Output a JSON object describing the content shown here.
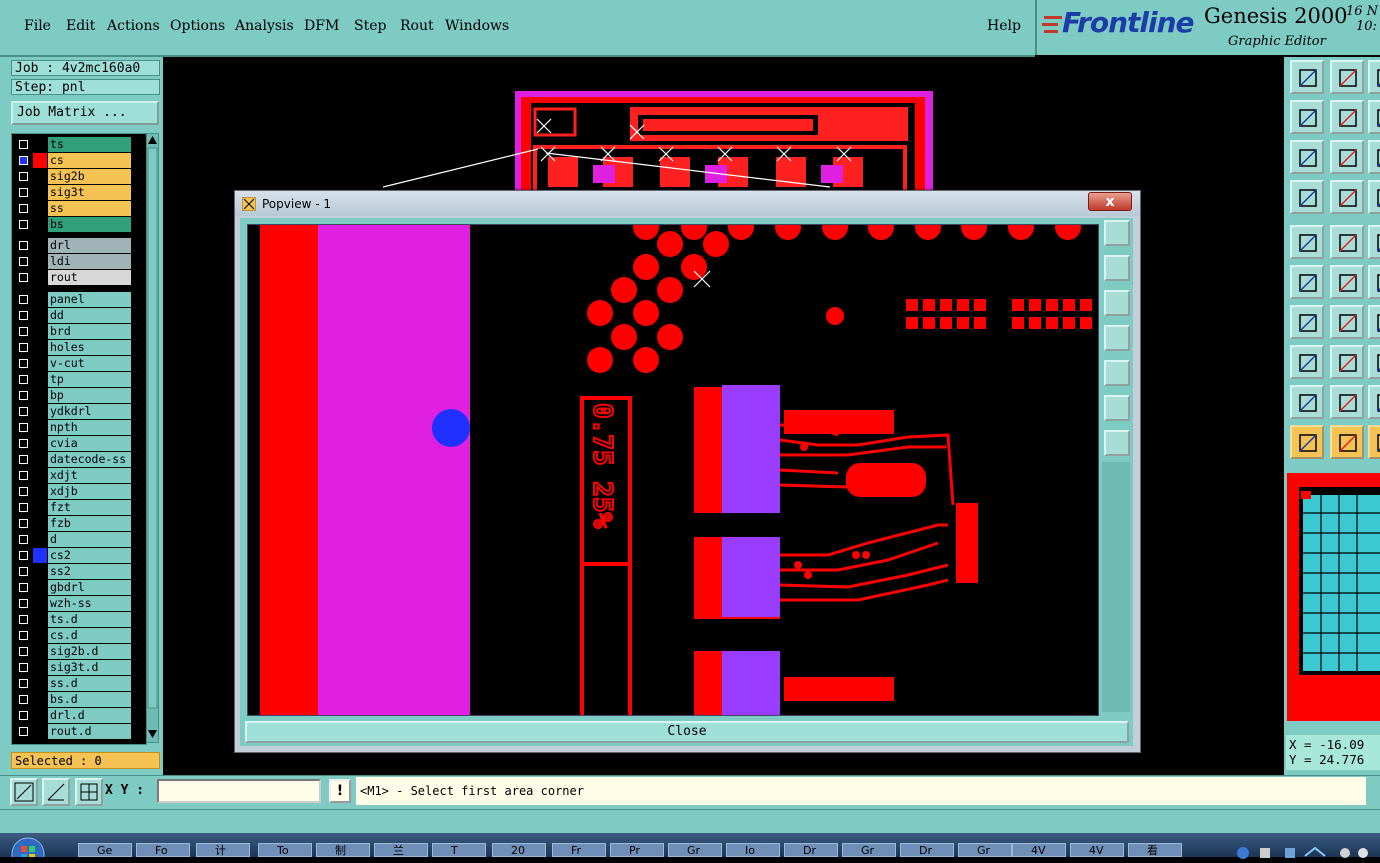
{
  "menu": {
    "file": "File",
    "edit": "Edit",
    "actions": "Actions",
    "options": "Options",
    "analysis": "Analysis",
    "dfm": "DFM",
    "step": "Step",
    "rout": "Rout",
    "windows": "Windows",
    "help": "Help"
  },
  "brand": {
    "logo": "Frontline",
    "product": "Genesis 2000",
    "subtitle": "Graphic Editor",
    "date_fragment": "16 N",
    "time_fragment": "10:"
  },
  "job": {
    "job_label": "Job : 4v2mc160a0",
    "step_label": "Step: pnl",
    "matrix_button": "Job Matrix ..."
  },
  "layers": [
    {
      "name": "ts",
      "bg": "#2fa07a",
      "swatch": "#000000"
    },
    {
      "name": "cs",
      "bg": "#f5c254",
      "swatch": "#ff0000",
      "active": true
    },
    {
      "name": "sig2b",
      "bg": "#f5c254",
      "swatch": "#000000"
    },
    {
      "name": "sig3t",
      "bg": "#f5c254",
      "swatch": "#000000"
    },
    {
      "name": "ss",
      "bg": "#f5c254",
      "swatch": "#000000"
    },
    {
      "name": "bs",
      "bg": "#2fa07a",
      "swatch": "#000000"
    },
    {
      "name": "drl",
      "bg": "#a0b4b8",
      "swatch": "#000000"
    },
    {
      "name": "ldi",
      "bg": "#a0b4b8",
      "swatch": "#000000"
    },
    {
      "name": "rout",
      "bg": "#d8d8d8",
      "swatch": "#000000"
    },
    {
      "name": "panel",
      "bg": "#7ecbc4",
      "swatch": "#000000"
    },
    {
      "name": "dd",
      "bg": "#7ecbc4",
      "swatch": "#000000"
    },
    {
      "name": "brd",
      "bg": "#7ecbc4",
      "swatch": "#000000"
    },
    {
      "name": "holes",
      "bg": "#7ecbc4",
      "swatch": "#000000"
    },
    {
      "name": "v-cut",
      "bg": "#7ecbc4",
      "swatch": "#000000"
    },
    {
      "name": "tp",
      "bg": "#7ecbc4",
      "swatch": "#000000"
    },
    {
      "name": "bp",
      "bg": "#7ecbc4",
      "swatch": "#000000"
    },
    {
      "name": "ydkdrl",
      "bg": "#7ecbc4",
      "swatch": "#000000"
    },
    {
      "name": "npth",
      "bg": "#7ecbc4",
      "swatch": "#000000"
    },
    {
      "name": "cvia",
      "bg": "#7ecbc4",
      "swatch": "#000000"
    },
    {
      "name": "datecode-ss",
      "bg": "#7ecbc4",
      "swatch": "#000000"
    },
    {
      "name": "xdjt",
      "bg": "#7ecbc4",
      "swatch": "#000000"
    },
    {
      "name": "xdjb",
      "bg": "#7ecbc4",
      "swatch": "#000000"
    },
    {
      "name": "fzt",
      "bg": "#7ecbc4",
      "swatch": "#000000"
    },
    {
      "name": "fzb",
      "bg": "#7ecbc4",
      "swatch": "#000000"
    },
    {
      "name": "d",
      "bg": "#7ecbc4",
      "swatch": "#000000"
    },
    {
      "name": "cs2",
      "bg": "#7ecbc4",
      "swatch": "#2030ff"
    },
    {
      "name": "ss2",
      "bg": "#7ecbc4",
      "swatch": "#000000"
    },
    {
      "name": "gbdrl",
      "bg": "#7ecbc4",
      "swatch": "#000000"
    },
    {
      "name": "wzh-ss",
      "bg": "#7ecbc4",
      "swatch": "#000000"
    },
    {
      "name": "ts.d",
      "bg": "#7ecbc4",
      "swatch": "#000000"
    },
    {
      "name": "cs.d",
      "bg": "#7ecbc4",
      "swatch": "#000000"
    },
    {
      "name": "sig2b.d",
      "bg": "#7ecbc4",
      "swatch": "#000000"
    },
    {
      "name": "sig3t.d",
      "bg": "#7ecbc4",
      "swatch": "#000000"
    },
    {
      "name": "ss.d",
      "bg": "#7ecbc4",
      "swatch": "#000000"
    },
    {
      "name": "bs.d",
      "bg": "#7ecbc4",
      "swatch": "#000000"
    },
    {
      "name": "drl.d",
      "bg": "#7ecbc4",
      "swatch": "#000000"
    },
    {
      "name": "rout.d",
      "bg": "#7ecbc4",
      "swatch": "#000000"
    }
  ],
  "selected": "Selected : 0",
  "coords": {
    "x": "X = -16.09",
    "y": "Y = 24.776"
  },
  "popview": {
    "title": "Popview - 1",
    "close_x": "x",
    "close_button": "Close",
    "board_text": "0.75 25%"
  },
  "command": {
    "xy_label": "X Y :",
    "xy_value": "",
    "bang": "!",
    "status": "<M1> - Select first area corner"
  },
  "taskbar": {
    "items": [
      "Ge",
      "Fo",
      "计",
      "To",
      "制",
      "兰",
      "T",
      "20",
      "Fr",
      "Pr",
      "Gr",
      "Io",
      "Dr",
      "Gr",
      "Dr",
      "Gr",
      "4V",
      "4V",
      "看"
    ]
  },
  "colors": {
    "panel": "#7ecbc4",
    "copper": "#ff0000",
    "silk": "#e020e0",
    "highlight": "#f5c254"
  }
}
